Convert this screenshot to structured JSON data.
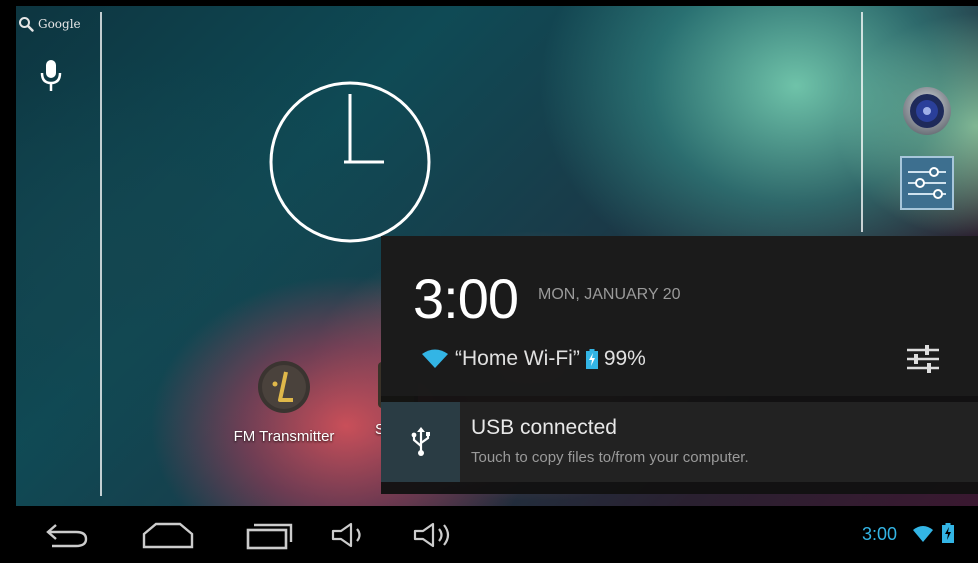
{
  "home": {
    "search_label": "Google",
    "apps": [
      {
        "label": "FM Transmitter"
      },
      {
        "label": "S"
      }
    ]
  },
  "notification_shade": {
    "time": "3:00",
    "date": "MON, JANUARY 20",
    "wifi_name": "“Home Wi-Fi”",
    "battery": "99%",
    "notifications": [
      {
        "title": "USB connected",
        "text": "Touch to copy files to/from your computer."
      }
    ]
  },
  "status_bar": {
    "time": "3:00"
  },
  "colors": {
    "accent": "#33b5e5",
    "shade_bg": "#1c1c1c"
  },
  "icons": {
    "search": "search-icon",
    "mic": "mic-icon",
    "speaker": "speaker-icon",
    "settings": "settings-sliders-icon",
    "usb": "usb-icon",
    "wifi": "wifi-icon",
    "battery": "battery-charging-icon",
    "back": "back-icon",
    "home": "home-icon",
    "recents": "recents-icon",
    "volume_down": "volume-down-icon",
    "volume_up": "volume-up-icon"
  }
}
